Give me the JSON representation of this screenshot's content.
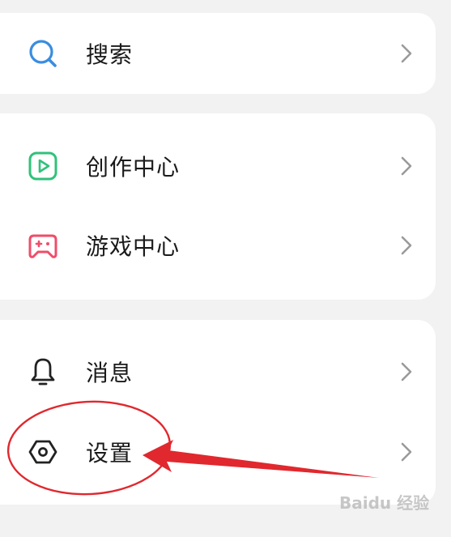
{
  "menu": {
    "group1": [
      {
        "label": "搜索",
        "icon": "search-icon",
        "color": "#3a8de0"
      }
    ],
    "group2": [
      {
        "label": "创作中心",
        "icon": "creator-play-icon",
        "color": "#2fc27a"
      },
      {
        "label": "游戏中心",
        "icon": "gamepad-icon",
        "color": "#ef4d6a"
      }
    ],
    "group3": [
      {
        "label": "消息",
        "icon": "bell-icon",
        "color": "#222222"
      },
      {
        "label": "设置",
        "icon": "settings-hexagon-icon",
        "color": "#222222"
      }
    ]
  },
  "annotation": {
    "color": "#e0282e",
    "highlighted_item": "设置"
  },
  "colors": {
    "page_background": "#f2f2f2",
    "card_background": "#ffffff",
    "chevron": "#9a9a9a"
  },
  "watermark": "Baidu 经验"
}
